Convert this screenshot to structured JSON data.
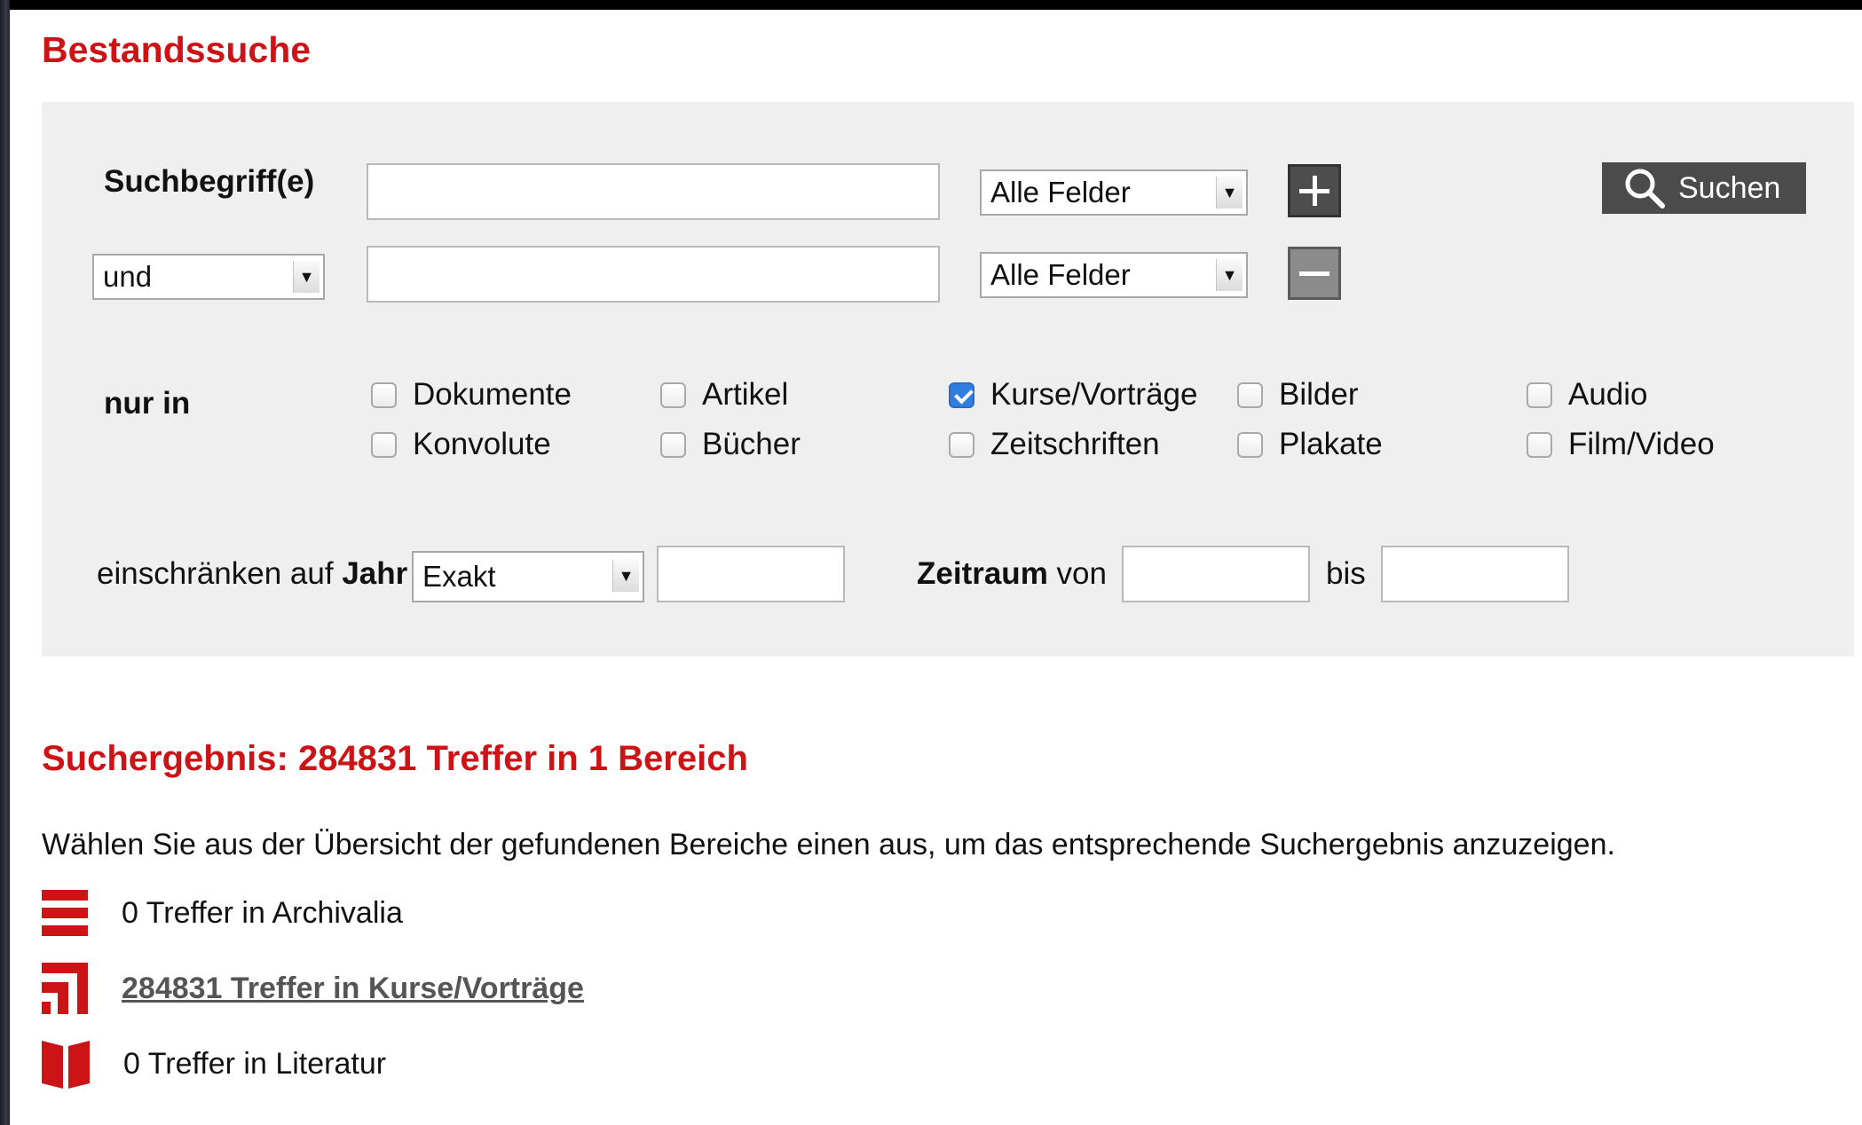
{
  "page": {
    "title": "Bestandssuche"
  },
  "search": {
    "term_label": "Suchbegriff(e)",
    "row1": {
      "value": "",
      "field_select": "Alle Felder"
    },
    "row2": {
      "operator": "und",
      "value": "",
      "field_select": "Alle Felder"
    },
    "search_button_label": "Suchen",
    "filter_label": "nur in",
    "categories": [
      {
        "label": "Dokumente",
        "checked": false
      },
      {
        "label": "Artikel",
        "checked": false
      },
      {
        "label": "Kurse/Vorträge",
        "checked": true
      },
      {
        "label": "Bilder",
        "checked": false
      },
      {
        "label": "Audio",
        "checked": false
      },
      {
        "label": "Konvolute",
        "checked": false
      },
      {
        "label": "Bücher",
        "checked": false
      },
      {
        "label": "Zeitschriften",
        "checked": false
      },
      {
        "label": "Plakate",
        "checked": false
      },
      {
        "label": "Film/Video",
        "checked": false
      }
    ],
    "year": {
      "label_prefix": "einschränken auf",
      "label_bold": "Jahr",
      "mode": "Exakt",
      "value": ""
    },
    "range": {
      "label_bold": "Zeitraum",
      "label_from": "von",
      "from_value": "",
      "label_to": "bis",
      "to_value": ""
    }
  },
  "results": {
    "title": "Suchergebnis: 284831 Treffer in 1 Bereich",
    "intro": "Wählen Sie aus der Übersicht der gefundenen Bereiche einen aus, um das entsprechende Suchergebnis anzuzeigen.",
    "areas": [
      {
        "label": "0 Treffer in Archivalia",
        "icon": "archive-icon",
        "link": false
      },
      {
        "label": "284831 Treffer in Kurse/Vorträge",
        "icon": "lectures-icon",
        "link": true
      },
      {
        "label": "0 Treffer in Literatur",
        "icon": "book-icon",
        "link": false
      }
    ]
  },
  "colors": {
    "accent_red": "#cc1417",
    "panel_bg": "#efefef",
    "button_dark": "#4b4b4b",
    "checkbox_checked": "#2f7de0"
  }
}
